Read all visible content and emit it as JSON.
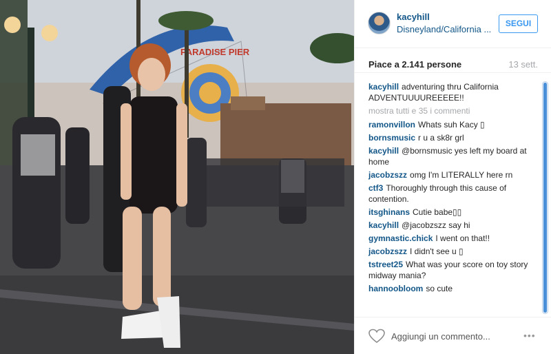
{
  "post": {
    "username": "kacyhill",
    "location": "Disneyland/California ...",
    "follow_label": "SEGUI",
    "likes_text": "Piace a 2.141 persone",
    "time_text": "13 sett.",
    "show_all_comments": "mostra tutti e 35 i commenti",
    "caption": {
      "author": "kacyhill",
      "text": "adventuring thru California ADVENTUUUUREEEEE!!"
    },
    "comments": [
      {
        "author": "ramonvillon",
        "text": "Whats suh Kacy ▯"
      },
      {
        "author": "bornsmusic",
        "text": "r u a sk8r grl"
      },
      {
        "author": "kacyhill",
        "text": "@bornsmusic yes left my board at home"
      },
      {
        "author": "jacobzszz",
        "text": "omg I'm LITERALLY here rn"
      },
      {
        "author": "ctf3",
        "text": "Thoroughly through this cause of contention."
      },
      {
        "author": "itsghinans",
        "text": "Cutie babe▯▯"
      },
      {
        "author": "kacyhill",
        "text": "@jacobzszz say hi"
      },
      {
        "author": "gymnastic.chick",
        "text": "I went on that!!"
      },
      {
        "author": "jacobzszz",
        "text": "I didn't see u ▯"
      },
      {
        "author": "tstreet25",
        "text": "What was your score on toy story midway mania?"
      },
      {
        "author": "hannoobloom",
        "text": "so cute"
      }
    ],
    "comment_placeholder": "Aggiungi un commento...",
    "more_options": "•••",
    "park_sign": "PARADISE PIER"
  },
  "icons": {
    "heart": "heart-outline-icon",
    "options": "more-options-icon"
  },
  "colors": {
    "link_blue": "#125688",
    "follow_blue": "#3897f0",
    "muted_gray": "#a5a7aa"
  }
}
